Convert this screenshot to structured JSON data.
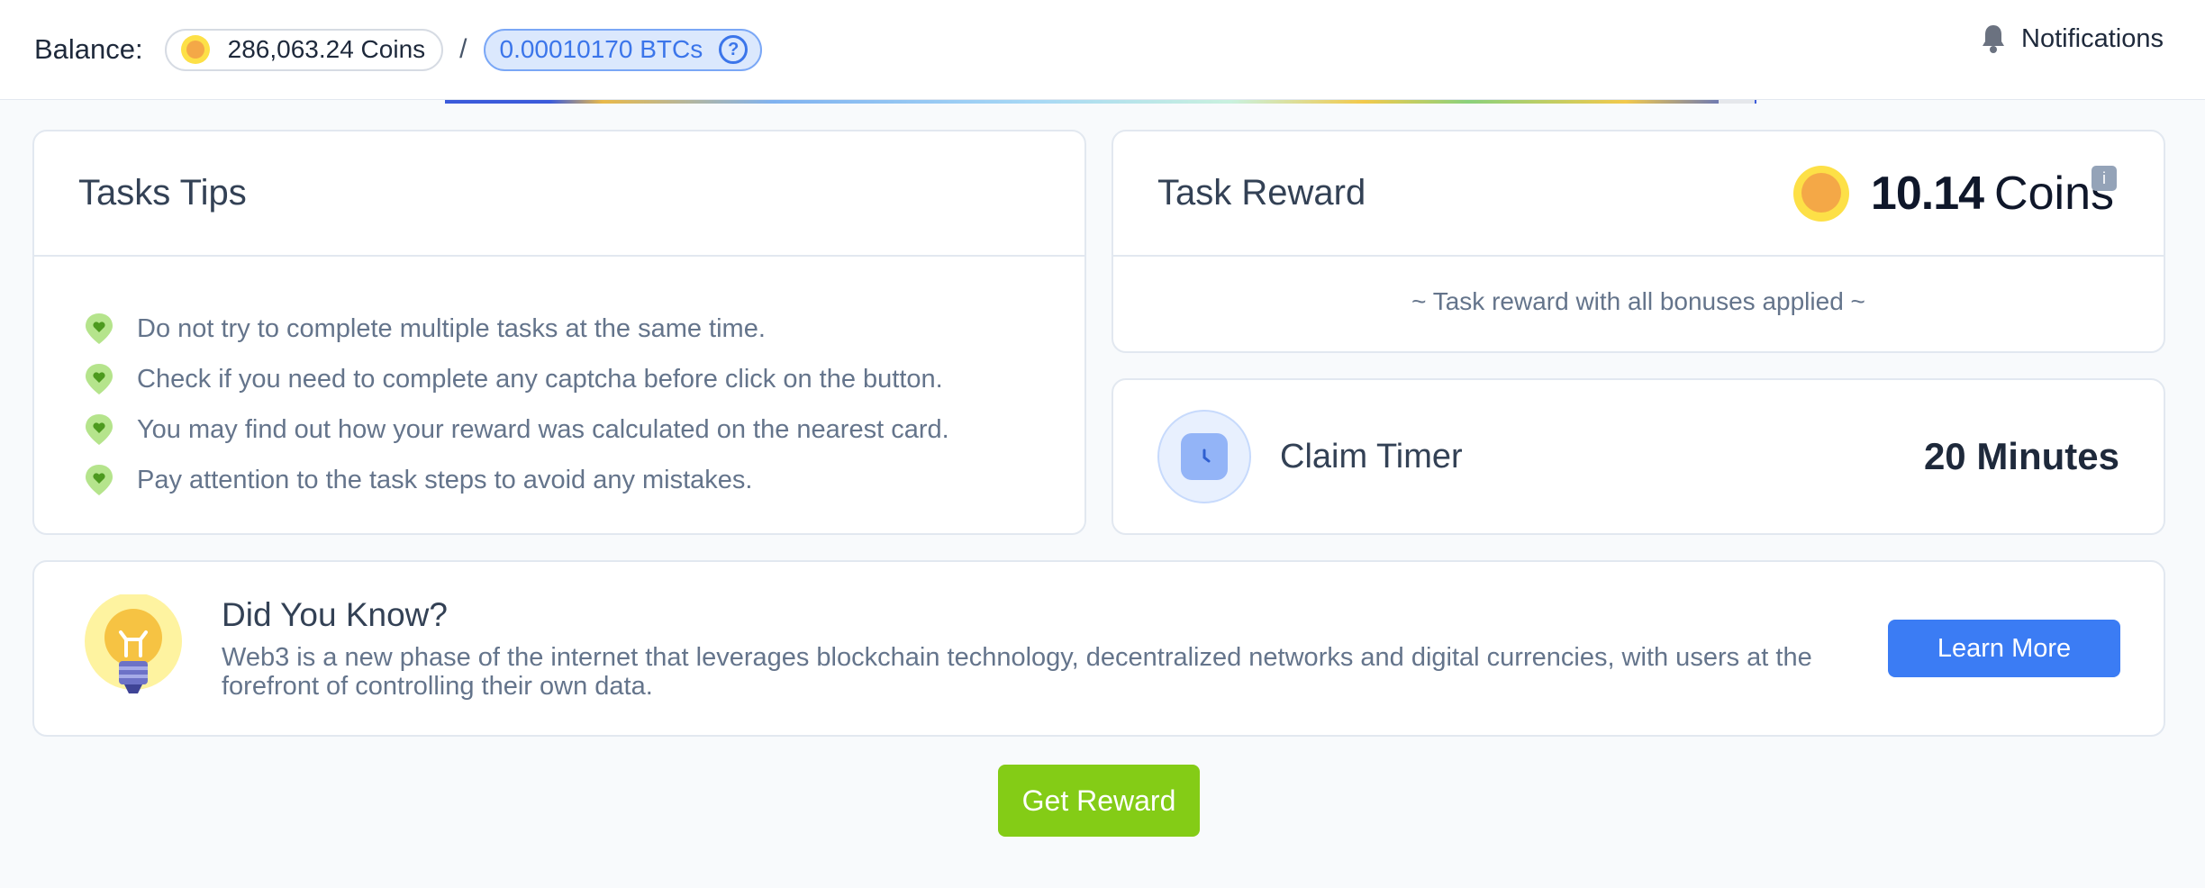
{
  "header": {
    "balance_label": "Balance:",
    "coins": "286,063.24 Coins",
    "separator": "/",
    "btc": "0.00010170 BTCs",
    "notifications": "Notifications"
  },
  "tips": {
    "title": "Tasks Tips",
    "items": [
      "Do not try to complete multiple tasks at the same time.",
      "Check if you need to complete any captcha before click on the button.",
      "You may find out how your reward was calculated on the nearest card.",
      "Pay attention to the task steps to avoid any mistakes."
    ]
  },
  "reward": {
    "title": "Task Reward",
    "value": "10.14",
    "unit": "Coins",
    "info": "i",
    "note": "~ Task reward with all bonuses applied ~"
  },
  "timer": {
    "label": "Claim Timer",
    "value": "20 Minutes"
  },
  "did_you_know": {
    "title": "Did You Know?",
    "body": "Web3 is a new phase of the internet that leverages blockchain technology, decentralized networks and digital currencies, with users at the forefront of controlling their own data.",
    "button": "Learn More"
  },
  "actions": {
    "get_reward": "Get Reward"
  },
  "icons": {
    "coin": "coin-icon",
    "help": "question-circle-icon",
    "bell": "bell-icon",
    "tip": "heart-pin-icon",
    "clock": "clock-icon",
    "bulb": "lightbulb-icon"
  },
  "colors": {
    "accent_blue": "#3b7cf4",
    "reward_green": "#84cc16",
    "tip_green": "#a3d977"
  }
}
